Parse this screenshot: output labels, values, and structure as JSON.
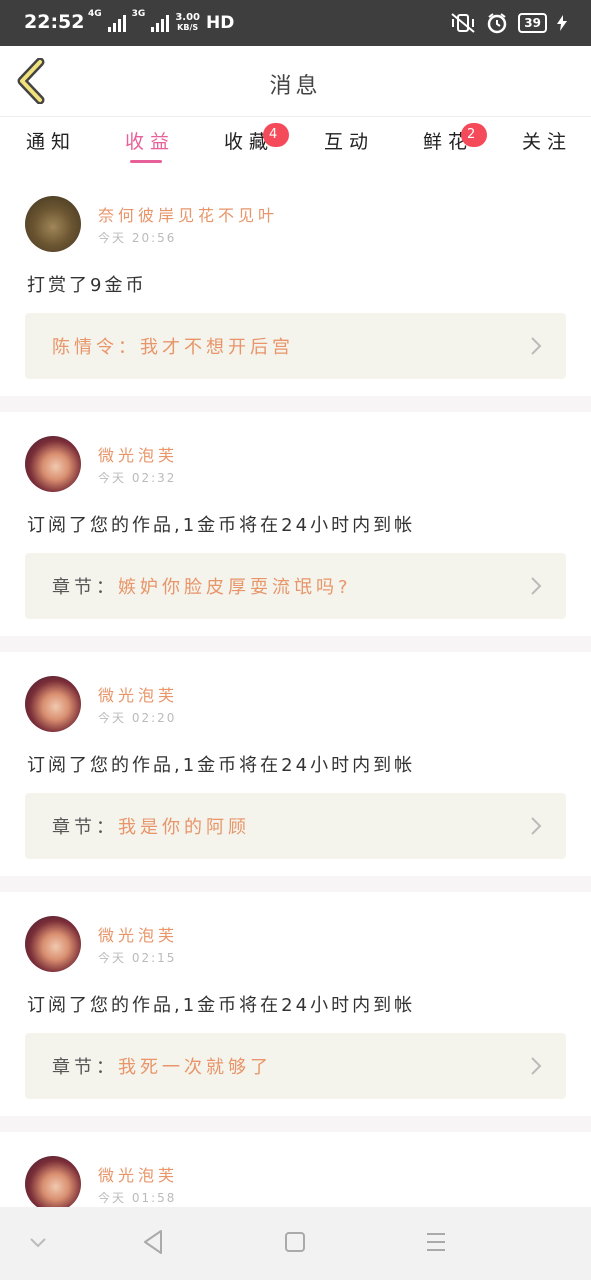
{
  "status": {
    "time": "22:52",
    "net1": "4G",
    "net2": "3G",
    "speed_top": "3.00",
    "speed_bottom": "KB/S",
    "hd": "HD",
    "battery": "39"
  },
  "header": {
    "title": "消息"
  },
  "tabs": [
    {
      "label": "通知"
    },
    {
      "label": "收益",
      "active": true
    },
    {
      "label": "收藏",
      "badge": "4"
    },
    {
      "label": "互动"
    },
    {
      "label": "鲜花",
      "badge": "2"
    },
    {
      "label": "关注"
    }
  ],
  "messages": [
    {
      "name": "奈何彼岸见花不见叶",
      "time": "今天 20:56",
      "text": "打赏了9金币",
      "quote_prefix": "",
      "quote": "陈情令：我才不想开后宫"
    },
    {
      "name": "微光泡芙",
      "time": "今天 02:32",
      "text": "订阅了您的作品,1金币将在24小时内到帐",
      "quote_prefix": "章节：",
      "quote": "嫉妒你脸皮厚耍流氓吗?"
    },
    {
      "name": "微光泡芙",
      "time": "今天 02:20",
      "text": "订阅了您的作品,1金币将在24小时内到帐",
      "quote_prefix": "章节：",
      "quote": "我是你的阿顾"
    },
    {
      "name": "微光泡芙",
      "time": "今天 02:15",
      "text": "订阅了您的作品,1金币将在24小时内到帐",
      "quote_prefix": "章节：",
      "quote": "我死一次就够了"
    },
    {
      "name": "微光泡芙",
      "time": "今天 01:58"
    }
  ],
  "colors": {
    "accent": "#e8609a",
    "name": "#e8956a",
    "badge": "#f44a5a",
    "quote_bg": "#f4f4ec"
  },
  "icons": {
    "back": "chevron-left-icon",
    "quote_arrow": "chevron-right-icon",
    "nav": [
      "collapse-icon",
      "back-triangle-icon",
      "home-square-icon",
      "menu-icon"
    ]
  }
}
